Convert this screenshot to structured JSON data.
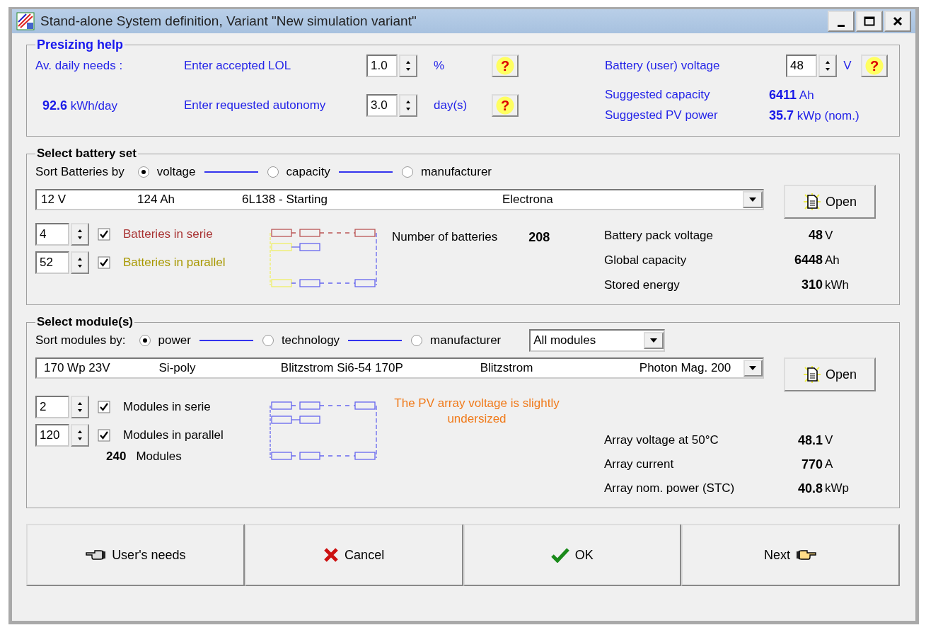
{
  "window": {
    "title": "Stand-alone System definition, Variant  \"New simulation variant\""
  },
  "presizing": {
    "title": "Presizing help",
    "daily_needs_label": "Av. daily needs :",
    "daily_needs_value": "92.6",
    "daily_needs_unit": "kWh/day",
    "lol": {
      "label": "Enter accepted LOL",
      "value": "1.0",
      "unit": "%",
      "help": "?"
    },
    "autonomy": {
      "label": "Enter requested autonomy",
      "value": "3.0",
      "unit": "day(s)",
      "help": "?"
    },
    "battery_voltage": {
      "label": "Battery (user) voltage",
      "value": "48",
      "unit": "V",
      "help": "?"
    },
    "suggested": [
      {
        "label": "Suggested capacity",
        "value": "6411",
        "unit": "Ah"
      },
      {
        "label": "Suggested PV power",
        "value": "35.7",
        "unit": "kWp (nom.)"
      }
    ]
  },
  "battery": {
    "title": "Select battery set",
    "sort_label": "Sort Batteries by",
    "sort_options": [
      {
        "label": "voltage",
        "selected": true
      },
      {
        "label": "capacity",
        "selected": false
      },
      {
        "label": "manufacturer",
        "selected": false
      }
    ],
    "selector": [
      "12 V",
      "124 Ah",
      "6L138 - Starting",
      "Electrona"
    ],
    "open_button": "Open",
    "series": {
      "value": "4",
      "checked": true,
      "label": "Batteries in serie"
    },
    "parallel": {
      "value": "52",
      "checked": true,
      "label": "Batteries in parallel"
    },
    "count_label": "Number of batteries",
    "count_value": "208",
    "stats": [
      {
        "label": "Battery pack voltage",
        "value": "48",
        "unit": "V"
      },
      {
        "label": "Global capacity",
        "value": "6448",
        "unit": "Ah"
      },
      {
        "label": "Stored energy",
        "value": "310",
        "unit": "kWh"
      }
    ]
  },
  "modules": {
    "title": "Select module(s)",
    "sort_label": "Sort modules by:",
    "sort_options": [
      {
        "label": "power",
        "selected": true
      },
      {
        "label": "technology",
        "selected": false
      },
      {
        "label": "manufacturer",
        "selected": false
      }
    ],
    "filter": "All modules",
    "selector": [
      "170 Wp 23V",
      "Si-poly",
      "Blitzstrom Si6-54 170P",
      "Blitzstrom",
      "Photon Mag. 200"
    ],
    "open_button": "Open",
    "series": {
      "value": "2",
      "checked": true,
      "label": "Modules in serie"
    },
    "parallel": {
      "value": "120",
      "checked": true,
      "label": "Modules in parallel"
    },
    "total_value": "240",
    "total_unit": "Modules",
    "warning": "The PV array voltage is slightly undersized",
    "stats": [
      {
        "label": "Array voltage at 50°C",
        "value": "48.1",
        "unit": "V"
      },
      {
        "label": "Array current",
        "value": "770",
        "unit": "A"
      },
      {
        "label": "Array nom. power (STC)",
        "value": "40.8",
        "unit": "kWp"
      }
    ]
  },
  "buttons": [
    {
      "label": "User's needs",
      "kind": "back"
    },
    {
      "label": "Cancel",
      "kind": "cancel"
    },
    {
      "label": "OK",
      "kind": "ok"
    },
    {
      "label": "Next",
      "kind": "next"
    }
  ]
}
